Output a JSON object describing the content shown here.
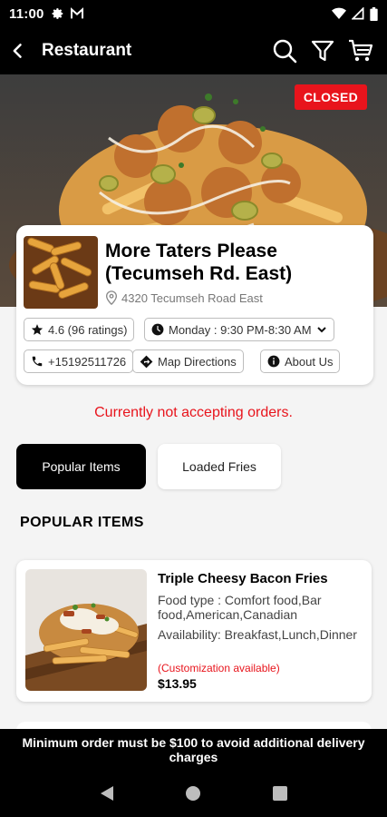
{
  "status_bar": {
    "time": "11:00",
    "icons": [
      "gear-icon",
      "mail-icon",
      "wifi-icon",
      "signal-icon",
      "battery-icon"
    ]
  },
  "app_bar": {
    "title": "Restaurant",
    "icons": [
      "back-arrow-icon",
      "search-icon",
      "filter-icon",
      "cart-icon"
    ]
  },
  "hero": {
    "badge": "CLOSED"
  },
  "restaurant": {
    "name": "More Taters Please (Tecumseh Rd. East)",
    "address": "4320 Tecumseh Road East",
    "rating": "4.6 (96 ratings)",
    "hours": "Monday : 9:30 PM-8:30 AM",
    "phone": "+15192511726",
    "directions": "Map Directions",
    "about": "About Us"
  },
  "status_message": "Currently not accepting orders.",
  "tabs": [
    {
      "label": "Popular Items",
      "active": true
    },
    {
      "label": "Loaded Fries",
      "active": false
    }
  ],
  "section_title": "POPULAR ITEMS",
  "items": [
    {
      "name": "Triple Cheesy Bacon Fries",
      "food_type": "Food type : Comfort food,Bar food,American,Canadian",
      "availability": "Availability: Breakfast,Lunch,Dinner",
      "customization": "(Customization available)",
      "price": "$13.95"
    }
  ],
  "notice": "Minimum order must be $100 to avoid additional delivery charges",
  "colors": {
    "accent_red": "#e8141c",
    "bar_black": "#000000",
    "background": "#f4f4f4"
  }
}
